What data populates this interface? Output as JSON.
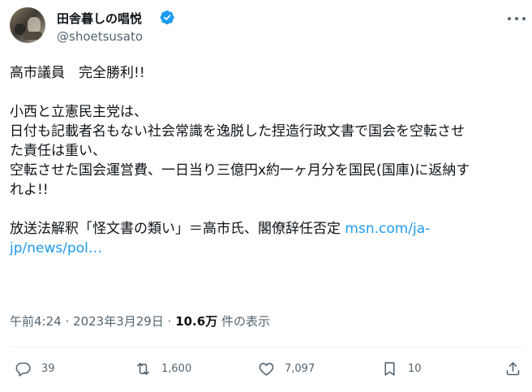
{
  "author": {
    "display_name": "田舎暮しの唱悦",
    "handle": "@shoetsusato"
  },
  "tweet": {
    "lines": [
      {
        "text": "高市議員　完全勝利!!"
      },
      {
        "text": ""
      },
      {
        "text": "小西と立憲民主党は、"
      },
      {
        "text": "日付も記載者名もない社会常識を逸脱した捏造行政文書で国会を空転させ"
      },
      {
        "text": "た責任は重い、"
      },
      {
        "text": "空転させた国会運営費、一日当り三億円x約一ヶ月分を国民(国庫)に返納す"
      },
      {
        "text": "れよ!!"
      },
      {
        "text": ""
      }
    ],
    "last_line_text": "放送法解釈「怪文書の類い」＝高市氏、閣僚辞任否定 ",
    "link_part1": "msn.com/ja-",
    "link_part2": "jp/news/pol…"
  },
  "meta": {
    "time": "午前4:24",
    "separator": "·",
    "date": "2023年3月29日",
    "separator2": "·",
    "views": "10.6万",
    "views_label": "件の表示"
  },
  "actions": {
    "reply_count": "39",
    "retweet_count": "1,600",
    "like_count": "7,097",
    "bookmark_count": "10"
  },
  "colors": {
    "text": "#0f1419",
    "secondary": "#536471",
    "link": "#1d9bf0",
    "verified": "#1d9bf0"
  },
  "icons": {
    "verified": "verified-badge-icon",
    "more": "more-options-icon",
    "reply": "reply-icon",
    "retweet": "retweet-icon",
    "like": "heart-icon",
    "bookmark": "bookmark-icon",
    "share": "share-icon"
  }
}
